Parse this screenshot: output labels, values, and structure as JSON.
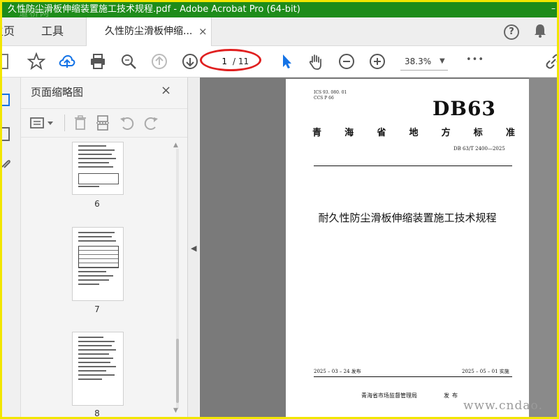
{
  "window": {
    "title": "久性防尘滑板伸缩装置施工技术规程.pdf - Adobe Acrobat Pro (64-bit)",
    "watermark_top": "道桥网",
    "minimize_label": "–"
  },
  "tabs": {
    "home": "主页",
    "tools": "工具",
    "document": "久性防尘滑板伸缩...",
    "close": "×"
  },
  "toolbar": {
    "current_page": "1",
    "total_pages": "/ 11",
    "zoom": "38.3%",
    "more": "•••"
  },
  "thumbnails": {
    "title": "页面缩略图",
    "close": "×",
    "pages": [
      {
        "number": "6"
      },
      {
        "number": "7"
      },
      {
        "number": "8"
      }
    ]
  },
  "document": {
    "ics_line1": "ICS   93. 080. 01",
    "ics_line2": "CCS   P 66",
    "code": "DB63",
    "province_chars": [
      "青",
      "海",
      "省",
      "地",
      "方",
      "标",
      "准"
    ],
    "std_number": "DB 63/T  2400—2025",
    "title": "耐久性防尘滑板伸缩装置施工技术规程",
    "publish_date": "2025 – 03 – 24 发布",
    "implement_date": "2025 – 05 – 01 实施",
    "issuer": "青海省市场监督管理局",
    "issue_word": "发布"
  },
  "site_watermark": "www.cndao.",
  "colors": {
    "titlebar": "#1e8c1a",
    "border": "#f2e600",
    "accent_blue": "#1473e6",
    "highlight_red": "#e02020"
  }
}
